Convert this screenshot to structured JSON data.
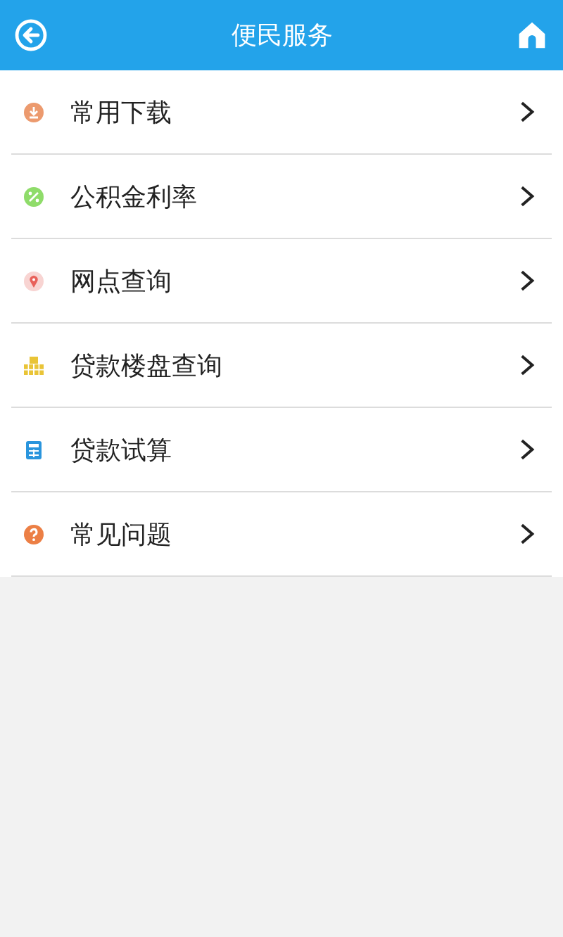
{
  "header": {
    "title": "便民服务"
  },
  "items": [
    {
      "label": "常用下载",
      "kind": "download"
    },
    {
      "label": "公积金利率",
      "kind": "percent"
    },
    {
      "label": "网点查询",
      "kind": "location"
    },
    {
      "label": "贷款楼盘查询",
      "kind": "buildings"
    },
    {
      "label": "贷款试算",
      "kind": "calculator"
    },
    {
      "label": "常见问题",
      "kind": "question"
    }
  ]
}
